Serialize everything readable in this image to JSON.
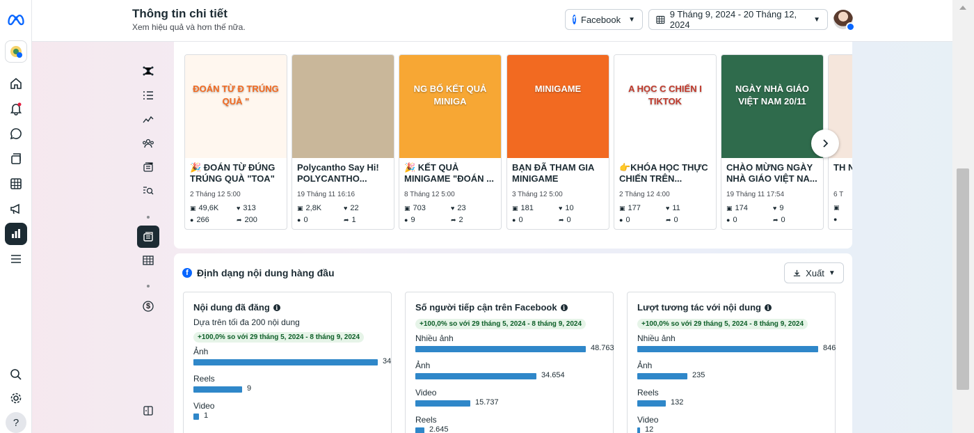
{
  "header": {
    "title": "Thông tin chi tiết",
    "subtitle": "Xem hiệu quả và hơn thế nữa.",
    "platform": "Facebook",
    "date_range": "9 Tháng 9, 2024 - 20 Tháng 12, 2024"
  },
  "rail": {
    "icons": [
      "meta-logo",
      "profile-icon",
      "home-icon",
      "notifications-icon",
      "messages-icon",
      "content-icon",
      "planner-icon",
      "ads-icon",
      "insights-icon",
      "menu-icon",
      "search-icon",
      "settings-icon",
      "help-icon"
    ],
    "help_label": "?"
  },
  "subnav": {
    "icons": [
      "overview-icon",
      "results-icon",
      "trend-icon",
      "audience-icon",
      "content-icon",
      "search-insights-icon",
      "content-active-icon",
      "table-icon",
      "monetization-icon",
      "panel-toggle-icon"
    ],
    "monetization_symbol": "$"
  },
  "posts": [
    {
      "caption": "🎉 ĐOÁN TỪ ĐÚNG TRÚNG QUÀ \"TOA\" ...",
      "date": "2 Tháng 12 5:00",
      "views": "49,6K",
      "likes": "313",
      "comments": "266",
      "shares": "200",
      "thumb_text": "ĐOÁN TỪ Đ TRÚNG QUÀ \"",
      "thumb_color": "#fff7ef"
    },
    {
      "caption": "Polycantho Say Hi! POLYCANTHO...",
      "date": "19 Tháng 11 16:16",
      "views": "2,8K",
      "likes": "22",
      "comments": "0",
      "shares": "1",
      "thumb_text": "",
      "thumb_color": "#c9b79a"
    },
    {
      "caption": "🎉 KẾT QUẢ MINIGAME \"ĐOÁN ...",
      "date": "8 Tháng 12 5:00",
      "views": "703",
      "likes": "23",
      "comments": "9",
      "shares": "2",
      "thumb_text": "NG BỐ KẾT QUẢ MINIGA",
      "thumb_color": "#f7a734"
    },
    {
      "caption": "BẠN ĐÃ THAM GIA MINIGAME CHƯA??...",
      "date": "3 Tháng 12 5:00",
      "views": "181",
      "likes": "10",
      "comments": "0",
      "shares": "0",
      "thumb_text": "MINIGAME",
      "thumb_color": "#f26a21"
    },
    {
      "caption": "👉KHÓA HỌC THỰC CHIẾN TRÊN...",
      "date": "2 Tháng 12 4:00",
      "views": "177",
      "likes": "11",
      "comments": "0",
      "shares": "0",
      "thumb_text": "A HỌC C CHIẾN I TIKTOK",
      "thumb_color": "#ffffff"
    },
    {
      "caption": "CHÀO MỪNG NGÀY NHÀ GIÁO VIỆT NA...",
      "date": "19 Tháng 11 17:54",
      "views": "174",
      "likes": "9",
      "comments": "0",
      "shares": "0",
      "thumb_text": "NGÀY NHÀ GIÁO VIỆT NAM 20/11",
      "thumb_color": "#2f6b4c"
    },
    {
      "caption": "TH NC",
      "date": "6 T",
      "views": "",
      "likes": "",
      "comments": "",
      "shares": "",
      "thumb_text": "",
      "thumb_color": "#f5e6dc"
    }
  ],
  "formats": {
    "heading": "Định dạng nội dung hàng đầu",
    "export_label": "Xuất",
    "panels": [
      {
        "title": "Nội dung đã đăng",
        "subtitle": "Dựa trên tối đa 200 nội dung",
        "badge": "+100,0% so với 29 tháng 5, 2024 - 8 tháng 9, 2024",
        "rows": [
          {
            "label": "Ảnh",
            "value": 34,
            "display": "34"
          },
          {
            "label": "Reels",
            "value": 9,
            "display": "9"
          },
          {
            "label": "Video",
            "value": 1,
            "display": "1"
          }
        ],
        "max": 34
      },
      {
        "title": "Số người tiếp cận trên Facebook",
        "subtitle": "",
        "badge": "+100,0% so với 29 tháng 5, 2024 - 8 tháng 9, 2024",
        "rows": [
          {
            "label": "Nhiều ảnh",
            "value": 48763,
            "display": "48.763"
          },
          {
            "label": "Ảnh",
            "value": 34654,
            "display": "34.654"
          },
          {
            "label": "Video",
            "value": 15737,
            "display": "15.737"
          },
          {
            "label": "Reels",
            "value": 2645,
            "display": "2.645"
          }
        ],
        "max": 48763
      },
      {
        "title": "Lượt tương tác với nội dung",
        "subtitle": "",
        "badge": "+100,0% so với 29 tháng 5, 2024 - 8 tháng 9, 2024",
        "rows": [
          {
            "label": "Nhiều ảnh",
            "value": 846,
            "display": "846"
          },
          {
            "label": "Ảnh",
            "value": 235,
            "display": "235"
          },
          {
            "label": "Reels",
            "value": 132,
            "display": "132"
          },
          {
            "label": "Video",
            "value": 12,
            "display": "12"
          }
        ],
        "max": 846
      }
    ]
  },
  "colors": {
    "accent": "#0866ff",
    "bar": "#2f87c9",
    "badge_bg": "#e6f4e8",
    "badge_text": "#0c5e27",
    "dark": "#1c2b33"
  }
}
